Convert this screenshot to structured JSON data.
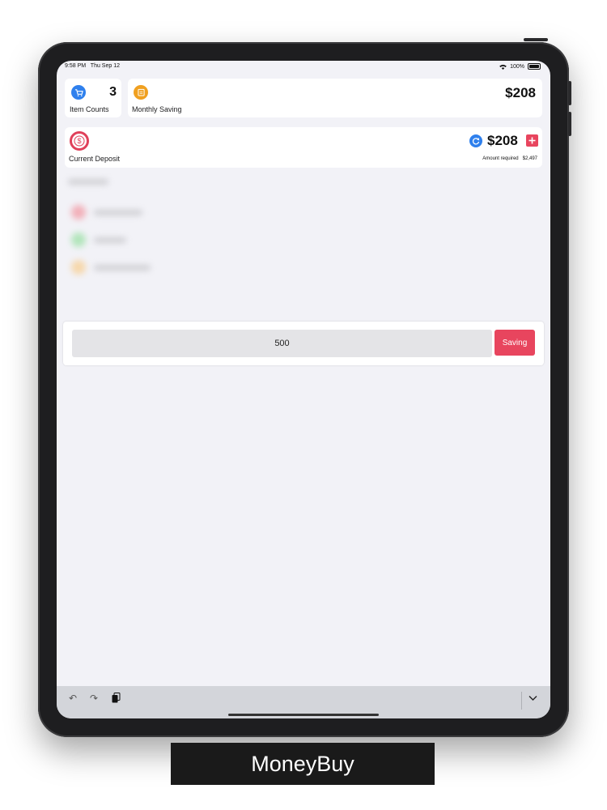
{
  "status_bar": {
    "time": "9:58 PM",
    "date": "Thu Sep 12",
    "battery": "100%"
  },
  "stats": {
    "item_count": {
      "value": "3",
      "label": "Item Counts",
      "icon": "cart-icon"
    },
    "monthly_saving": {
      "value": "$208",
      "label": "Monthly Saving",
      "icon": "calendar-icon"
    }
  },
  "deposit": {
    "label": "Current Deposit",
    "value": "$208",
    "required_label": "Amount required",
    "required_value": "$2,497",
    "icons": [
      "dollar-icon",
      "refresh-icon",
      "plus-icon"
    ]
  },
  "saving_form": {
    "amount_value": "500",
    "button_label": "Saving"
  },
  "caption": "MoneyBuy",
  "colors": {
    "accent_red": "#e8455e",
    "accent_blue": "#2f80ed",
    "accent_orange": "#f0a020"
  }
}
